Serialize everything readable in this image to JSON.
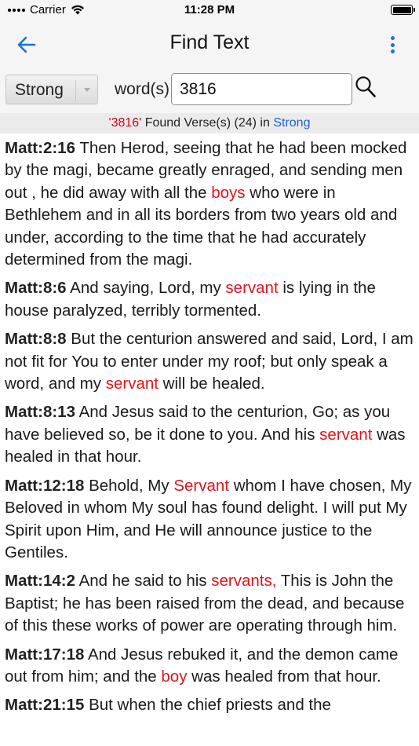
{
  "status": {
    "carrier": "Carrier",
    "time": "11:28 PM"
  },
  "nav": {
    "title": "Find Text",
    "back_icon": "arrow-left-icon",
    "more_icon": "more-vertical-icon"
  },
  "search": {
    "type_selected": "Strong",
    "words_label": "word(s)",
    "query_value": "3816",
    "search_icon": "magnifier-icon"
  },
  "result": {
    "query": "'3816'",
    "found_text": "Found Verse(s) (24) in",
    "source": "Strong"
  },
  "colors": {
    "accent": "#1e72d6",
    "highlight": "#e0141e",
    "result_query": "#d0021b"
  },
  "verses": [
    {
      "ref": "Matt:2:16",
      "parts": [
        {
          "text": " Then Herod, seeing that he had been mocked by the magi, became greatly enraged, and sending men out , he did away with all the ",
          "hl": false
        },
        {
          "text": "boys",
          "hl": true
        },
        {
          "text": " who were in Bethlehem and in all its borders from two years old and under, according to the time that he had accurately determined from the magi.",
          "hl": false
        }
      ]
    },
    {
      "ref": "Matt:8:6",
      "parts": [
        {
          "text": " And saying, Lord, my ",
          "hl": false
        },
        {
          "text": "servant",
          "hl": true
        },
        {
          "text": " is lying in the house paralyzed, terribly tormented.",
          "hl": false
        }
      ]
    },
    {
      "ref": "Matt:8:8",
      "parts": [
        {
          "text": " But the centurion answered and said, Lord, I am not fit for You to enter under my roof; but only speak a word, and my ",
          "hl": false
        },
        {
          "text": "servant",
          "hl": true
        },
        {
          "text": " will be healed.",
          "hl": false
        }
      ]
    },
    {
      "ref": "Matt:8:13",
      "parts": [
        {
          "text": " And Jesus said to the centurion, Go; as you have believed so, be it done to you. And his ",
          "hl": false
        },
        {
          "text": "servant",
          "hl": true
        },
        {
          "text": " was healed in that hour.",
          "hl": false
        }
      ]
    },
    {
      "ref": "Matt:12:18",
      "parts": [
        {
          "text": " Behold, My ",
          "hl": false
        },
        {
          "text": "Servant",
          "hl": true
        },
        {
          "text": " whom I have chosen, My Beloved in whom My soul has found delight. I will put My Spirit upon Him, and He will announce justice to the Gentiles.",
          "hl": false
        }
      ]
    },
    {
      "ref": "Matt:14:2",
      "parts": [
        {
          "text": " And he said to his ",
          "hl": false
        },
        {
          "text": "servants,",
          "hl": true
        },
        {
          "text": " This is John the Baptist; he has been raised from the dead, and because of this these works of power are operating through him.",
          "hl": false
        }
      ]
    },
    {
      "ref": "Matt:17:18",
      "parts": [
        {
          "text": " And Jesus rebuked it, and the demon came out from him; and the ",
          "hl": false
        },
        {
          "text": "boy",
          "hl": true
        },
        {
          "text": " was healed from that hour.",
          "hl": false
        }
      ]
    },
    {
      "ref": "Matt:21:15",
      "parts": [
        {
          "text": " But when the chief priests and the",
          "hl": false
        }
      ]
    }
  ]
}
